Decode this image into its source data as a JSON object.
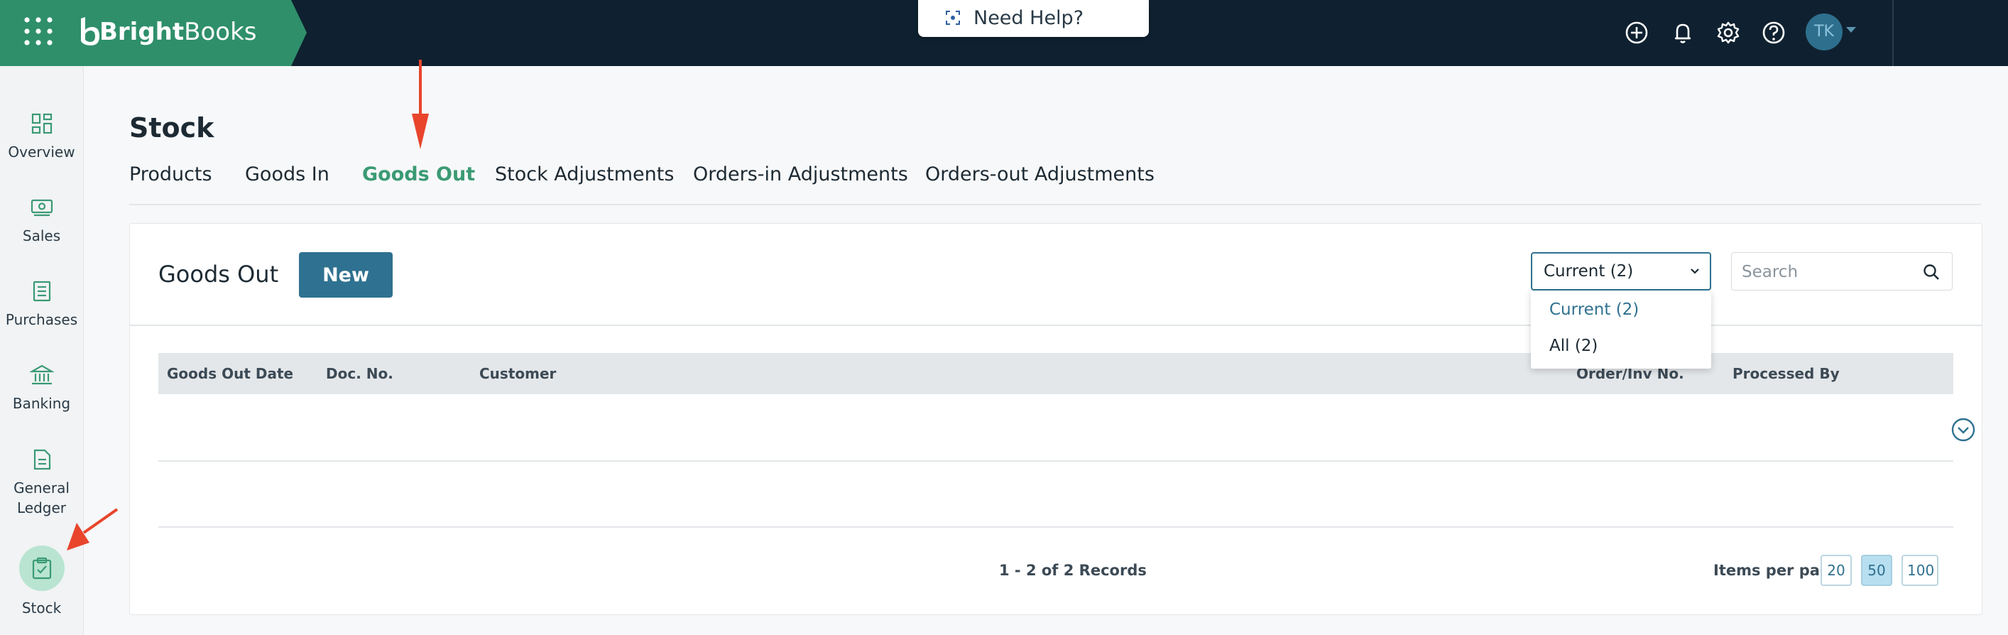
{
  "app": {
    "brand_part1": "Bright",
    "brand_part2": "Books",
    "help_label": "Need Help?",
    "avatar_initials": "TK"
  },
  "topbar_icons": [
    "plus-circle-icon",
    "bell-icon",
    "gear-icon",
    "question-circle-icon"
  ],
  "sidebar": {
    "items": [
      {
        "label": "Overview",
        "icon": "dashboard-icon"
      },
      {
        "label": "Sales",
        "icon": "cash-icon"
      },
      {
        "label": "Purchases",
        "icon": "receipt-icon"
      },
      {
        "label": "Banking",
        "icon": "bank-icon"
      },
      {
        "label": "General Ledger",
        "icon": "ledger-icon"
      },
      {
        "label": "Stock",
        "icon": "clipboard-check-icon",
        "active": true
      }
    ]
  },
  "page": {
    "title": "Stock"
  },
  "tabs": [
    {
      "label": "Products"
    },
    {
      "label": "Goods In"
    },
    {
      "label": "Goods Out",
      "active": true
    },
    {
      "label": "Stock Adjustments"
    },
    {
      "label": "Orders-in Adjustments"
    },
    {
      "label": "Orders-out Adjustments"
    }
  ],
  "card": {
    "title": "Goods Out",
    "new_label": "New",
    "filter": {
      "selected": "Current (2)",
      "options": [
        "Current (2)",
        "All (2)"
      ]
    },
    "search": {
      "placeholder": "Search"
    }
  },
  "table": {
    "columns": [
      "Goods Out Date",
      "Doc. No.",
      "Customer",
      "Order/Inv No.",
      "Processed By"
    ]
  },
  "pagination": {
    "records": "1 - 2 of 2 Records",
    "items_per_page_label": "Items per page",
    "sizes": [
      "20",
      "50",
      "100"
    ],
    "active_size": "50"
  },
  "colors": {
    "topbar": "#0f2130",
    "brand": "#2f8f6b",
    "accent": "#3a9a74",
    "primary_button": "#2f7190",
    "annotation_arrow": "#e8452c"
  }
}
